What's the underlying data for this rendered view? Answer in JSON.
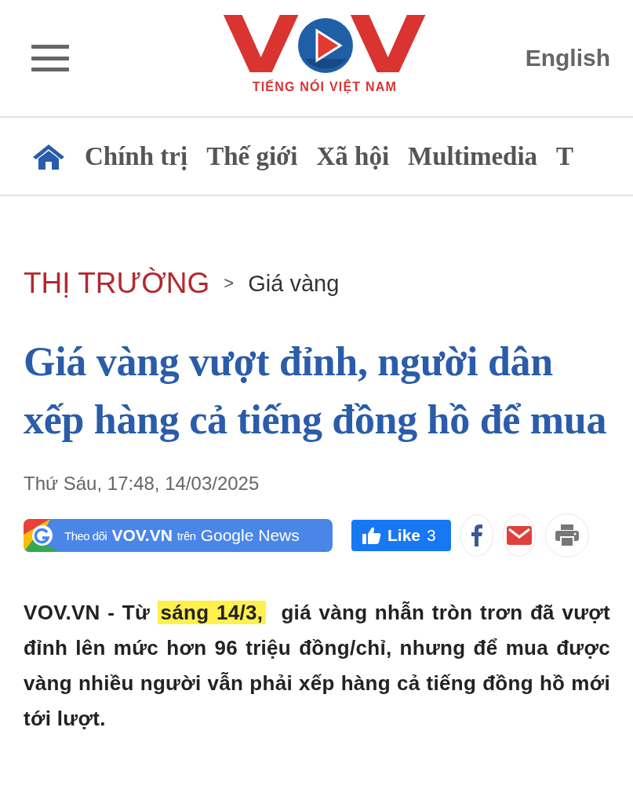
{
  "header": {
    "logo": {
      "letters": [
        "V",
        "V"
      ],
      "tagline": "TIẾNG NÓI VIỆT NAM"
    },
    "language_link": "English"
  },
  "nav": {
    "items": [
      {
        "label": "Chính trị"
      },
      {
        "label": "Thế giới"
      },
      {
        "label": "Xã hội"
      },
      {
        "label": "Multimedia"
      },
      {
        "label": "T"
      }
    ]
  },
  "breadcrumb": {
    "category": "THỊ TRƯỜNG",
    "separator": ">",
    "subcategory": "Giá vàng"
  },
  "headline": "Giá vàng vượt đỉnh, người dân xếp hàng cả tiếng đồng hồ để mua",
  "date": "Thứ Sáu, 17:48, 14/03/2025",
  "follow_button": {
    "prefix": "Theo dõi",
    "brand": "VOV.VN",
    "middle": "trên",
    "service": "Google News"
  },
  "like_button": {
    "label": "Like",
    "count": "3"
  },
  "lead": {
    "before": "VOV.VN - Từ ",
    "highlight": "sáng 14/3,",
    "after": "  giá vàng nhẫn tròn trơn đã vượt đỉnh lên mức hơn 96 triệu đồng/chỉ, nhưng để mua được vàng nhiều người vẫn phải xếp hàng cả tiếng đồng hồ mới tới lượt."
  }
}
